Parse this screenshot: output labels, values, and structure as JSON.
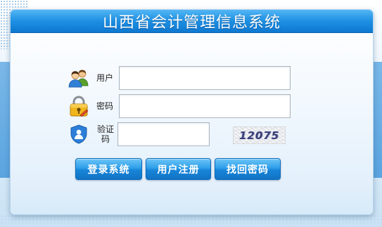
{
  "window": {
    "title": "山西省会计管理信息系统"
  },
  "form": {
    "username": {
      "label": "用户",
      "value": ""
    },
    "password": {
      "label": "密码",
      "value": ""
    },
    "captcha": {
      "label_line1": "验证",
      "label_line2": "码",
      "value": "",
      "image_text": "12075"
    }
  },
  "buttons": {
    "login": "登录系统",
    "register": "用户注册",
    "recover": "找回密码"
  },
  "colors": {
    "title_bar": "#1d8fe2",
    "button": "#2f9ee9",
    "panel_bg": "#e3f0fb"
  },
  "icons": {
    "username": "users-icon",
    "password": "lock-icon",
    "captcha": "shield-user-icon"
  }
}
